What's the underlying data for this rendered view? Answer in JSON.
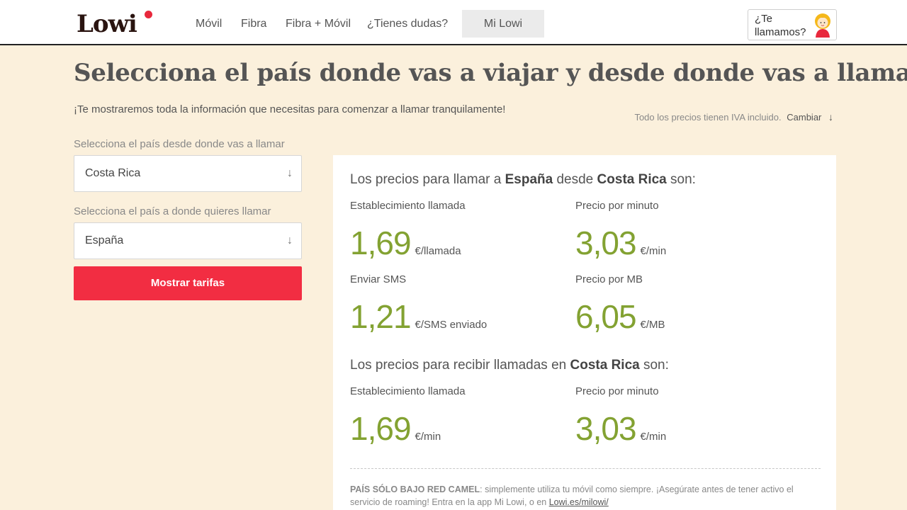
{
  "header": {
    "logo": "Lowi",
    "nav": [
      "Móvil",
      "Fibra",
      "Fibra + Móvil",
      "¿Tienes dudas?"
    ],
    "mi_lowi": "Mi Lowi",
    "callme": "¿Te llamamos?"
  },
  "main": {
    "title": "Selecciona el país donde vas a viajar y desde donde vas a llamar:",
    "subtitle": "¡Te mostraremos toda la información que necesitas para comenzar a llamar tranquilamente!",
    "iva_text": "Todo los precios tienen IVA incluido.",
    "iva_link": "Cambiar",
    "from_label": "Selecciona el país desde donde vas a llamar",
    "from_value": "Costa Rica",
    "to_label": "Selecciona el país a donde quieres llamar",
    "to_value": "España",
    "button": "Mostrar tarifas"
  },
  "results": {
    "call_heading": {
      "prefix": "Los precios para llamar a",
      "dest": "España",
      "mid": "desde",
      "origin": "Costa Rica",
      "suffix": "son:"
    },
    "call_metrics": [
      {
        "label": "Establecimiento llamada",
        "value": "1,69",
        "unit": "€/llamada"
      },
      {
        "label": "Precio por minuto",
        "value": "3,03",
        "unit": "€/min"
      },
      {
        "label": "Enviar SMS",
        "value": "1,21",
        "unit": "€/SMS enviado"
      },
      {
        "label": "Precio por MB",
        "value": "6,05",
        "unit": "€/MB"
      }
    ],
    "receive_heading": {
      "prefix": "Los precios para recibir llamadas en",
      "origin": "Costa Rica",
      "suffix": "son:"
    },
    "receive_metrics": [
      {
        "label": "Establecimiento llamada",
        "value": "1,69",
        "unit": "€/min"
      },
      {
        "label": "Precio por minuto",
        "value": "3,03",
        "unit": "€/min"
      }
    ],
    "note": {
      "strong": "País sólo bajo red Camel",
      "text": ": simplemente utiliza tu móvil como siempre. ¡Asegúrate antes de tener activo el servicio de roaming! Entra en la app Mi Lowi, o en",
      "link": "Lowi.es/milowi/"
    }
  },
  "colors": {
    "background": "#fbf0dc",
    "accent_red": "#f22d42",
    "price_green": "#83a232"
  },
  "icons": [
    "arrow-down-icon",
    "avatar-icon"
  ]
}
